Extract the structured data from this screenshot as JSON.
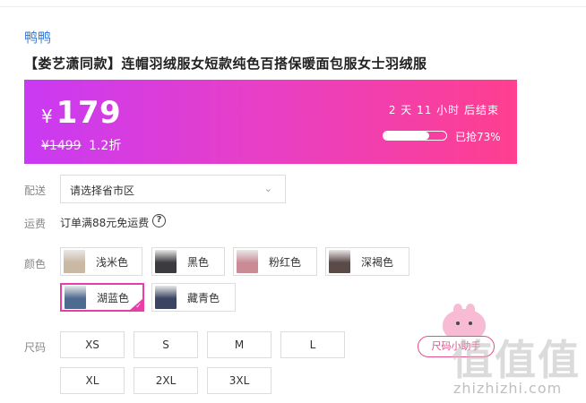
{
  "product": {
    "brand": "鸭鸭",
    "title": "【娄艺潇同款】连帽羽绒服女短款纯色百搭保暖面包服女士羽绒服"
  },
  "promo": {
    "currency": "¥",
    "price": "179",
    "original_price": "¥1499",
    "discount": "1.2折",
    "countdown": "2 天 11 小时 后结束",
    "sold_text": "已抢73%",
    "sold_percent": 73,
    "gradient_start": "#c93af3",
    "gradient_end": "#ff3f8f"
  },
  "delivery": {
    "label": "配送",
    "select_value": "请选择省市区"
  },
  "freight": {
    "label": "运费",
    "text": "订单满88元免运费",
    "help_icon": "?"
  },
  "colors": {
    "label": "颜色",
    "options": [
      {
        "name": "浅米色",
        "swatch": "#c9b8a3",
        "selected": false
      },
      {
        "name": "黑色",
        "swatch": "#3a3a3f",
        "selected": false
      },
      {
        "name": "粉红色",
        "swatch": "#c98c95",
        "selected": false
      },
      {
        "name": "深褐色",
        "swatch": "#5a4a48",
        "selected": false
      },
      {
        "name": "湖蓝色",
        "swatch": "#4d6a8f",
        "selected": true
      },
      {
        "name": "藏青色",
        "swatch": "#3b4460",
        "selected": false
      }
    ]
  },
  "sizes": {
    "label": "尺码",
    "options": [
      "XS",
      "S",
      "M",
      "L",
      "XL",
      "2XL",
      "3XL"
    ],
    "guide_label": "尺码小助手"
  },
  "watermark": {
    "text": "值值值",
    "url": "zhizhizhi.com"
  },
  "accent_color": "#e83ea8"
}
